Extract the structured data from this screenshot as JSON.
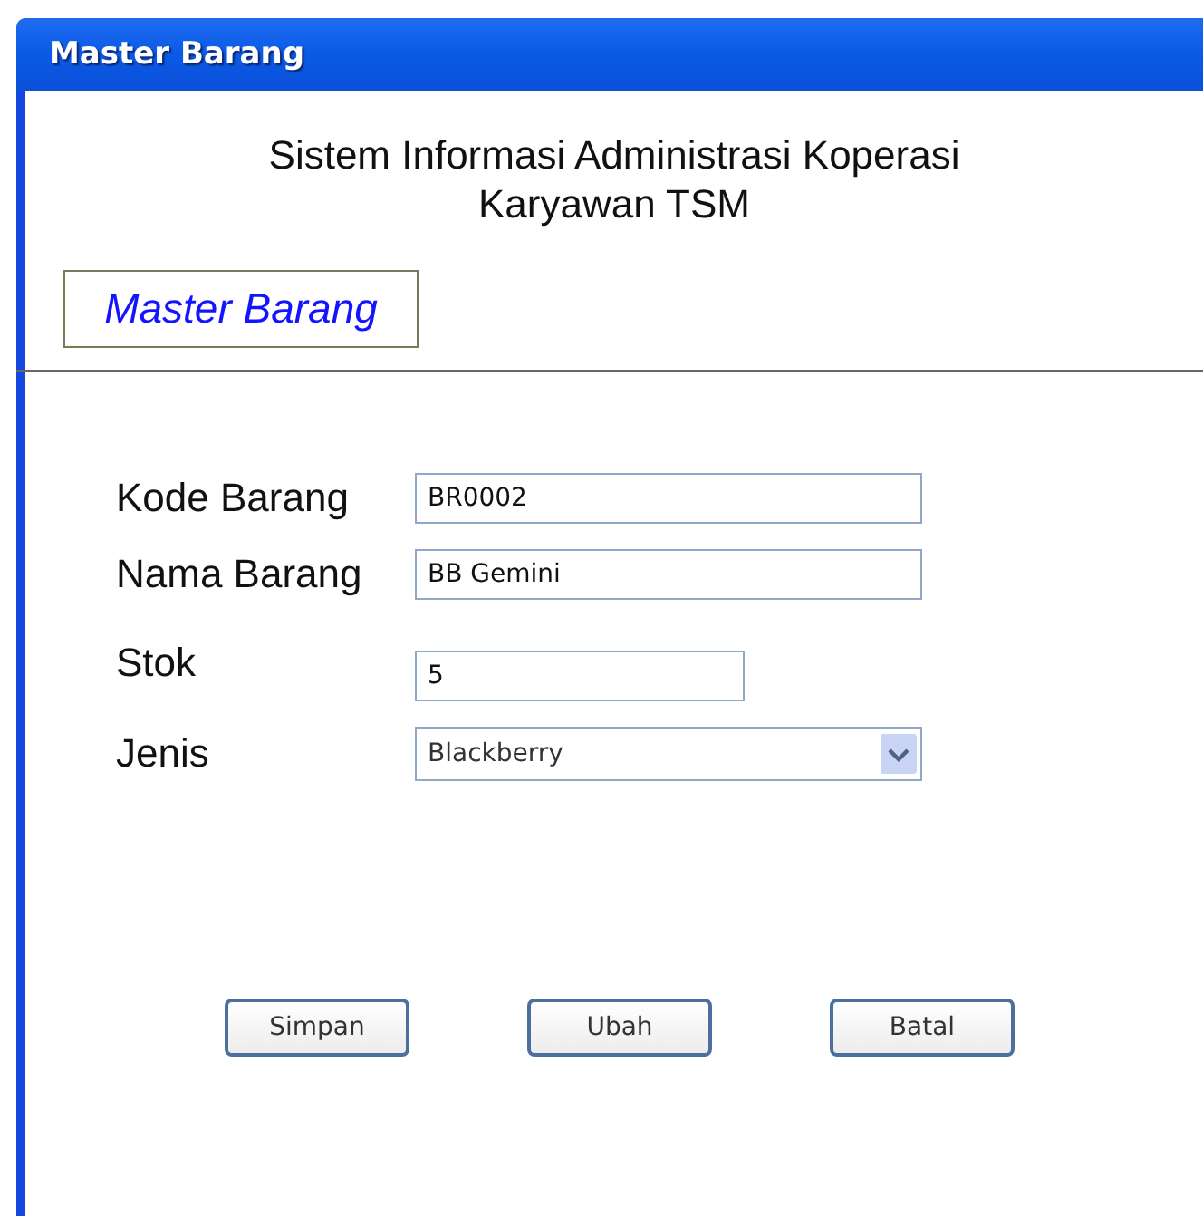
{
  "window": {
    "title": "Master Barang"
  },
  "heading": [
    "Sistem Informasi Administrasi Koperasi",
    "Karyawan TSM"
  ],
  "section_label": "Master Barang",
  "fields": [
    {
      "kind": "text",
      "label": "Kode Barang",
      "value": "BR0002"
    },
    {
      "kind": "text",
      "label": "Nama Barang",
      "value": "BB Gemini"
    },
    {
      "kind": "short",
      "label": "Stok",
      "value": "5"
    },
    {
      "kind": "select",
      "label": "Jenis",
      "value": "Blackberry"
    }
  ],
  "buttons": [
    "Simpan",
    "Ubah",
    "Batal"
  ]
}
